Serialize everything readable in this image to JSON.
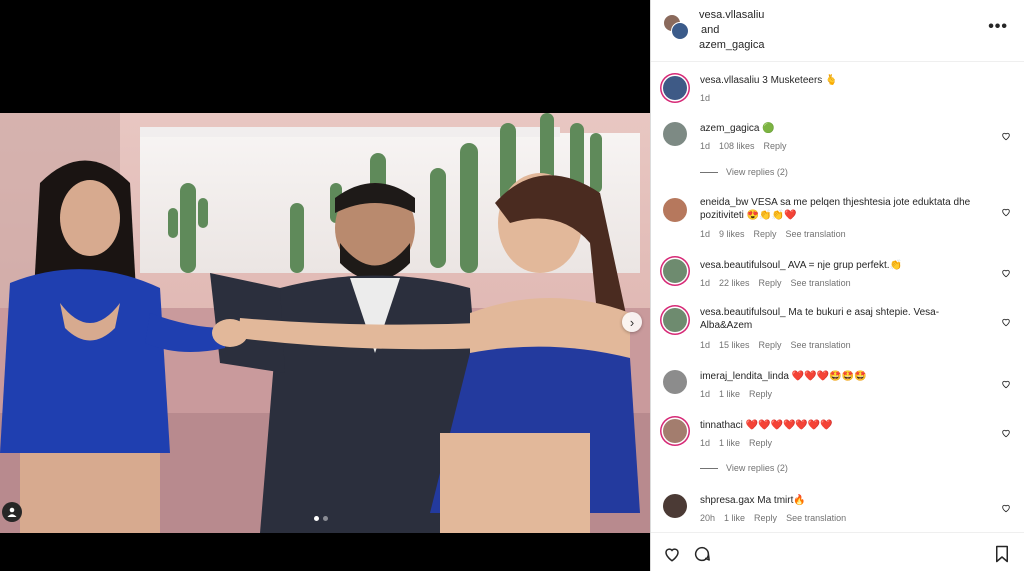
{
  "header": {
    "user1": "vesa.vllasaliu",
    "conjunction": "and",
    "user2": "azem_gagica",
    "more": "•••"
  },
  "comments": [
    {
      "user": "vesa.vllasaliu",
      "text": "3 Musketeers 🫰",
      "age": "1d",
      "likes": "",
      "reply": "",
      "translate": "",
      "avatar_color": "#3e5a86"
    },
    {
      "user": "azem_gagica",
      "text": "🟢",
      "age": "1d",
      "likes": "108 likes",
      "reply": "Reply",
      "translate": "",
      "avatar_color": "#7d8a84"
    },
    {
      "user": "eneida_bw",
      "text": "VESA sa me pelqen thjeshtesia jote eduktata dhe pozitiviteti 😍👏👏❤️",
      "age": "1d",
      "likes": "9 likes",
      "reply": "Reply",
      "translate": "See translation",
      "avatar_color": "#b6785d"
    },
    {
      "user": "vesa.beautifulsoul_",
      "text": "AVA = nje grup perfekt.👏",
      "age": "1d",
      "likes": "22 likes",
      "reply": "Reply",
      "translate": "See translation",
      "avatar_color": "#6e8b6f"
    },
    {
      "user": "vesa.beautifulsoul_",
      "text": "Ma te bukuri e asaj shtepie. Vesa-Alba&Azem",
      "age": "1d",
      "likes": "15 likes",
      "reply": "Reply",
      "translate": "See translation",
      "avatar_color": "#6e8b6f"
    },
    {
      "user": "imeraj_lendita_linda",
      "text": "❤️❤️❤️🤩🤩🤩",
      "age": "1d",
      "likes": "1 like",
      "reply": "Reply",
      "translate": "",
      "avatar_color": "#8c8c8c"
    },
    {
      "user": "tinnathaci",
      "text": "❤️❤️❤️❤️❤️❤️❤️",
      "age": "1d",
      "likes": "1 like",
      "reply": "Reply",
      "translate": "",
      "avatar_color": "#a37d6e"
    },
    {
      "user": "shpresa.gax",
      "text": "Ma tmirt🔥",
      "age": "20h",
      "likes": "1 like",
      "reply": "Reply",
      "translate": "See translation",
      "avatar_color": "#4b3a35"
    }
  ],
  "view_replies": [
    "View replies (2)",
    "View replies (2)"
  ],
  "icons": {
    "like": "heart-icon",
    "comment": "comment-icon",
    "save": "bookmark-icon",
    "next": "chevron-right-icon",
    "tag": "user-tag-icon"
  },
  "carousel": {
    "count": 2,
    "active": 1
  },
  "colors": {
    "story_ring": "#d62976",
    "meta": "#737373",
    "text": "#262626"
  }
}
